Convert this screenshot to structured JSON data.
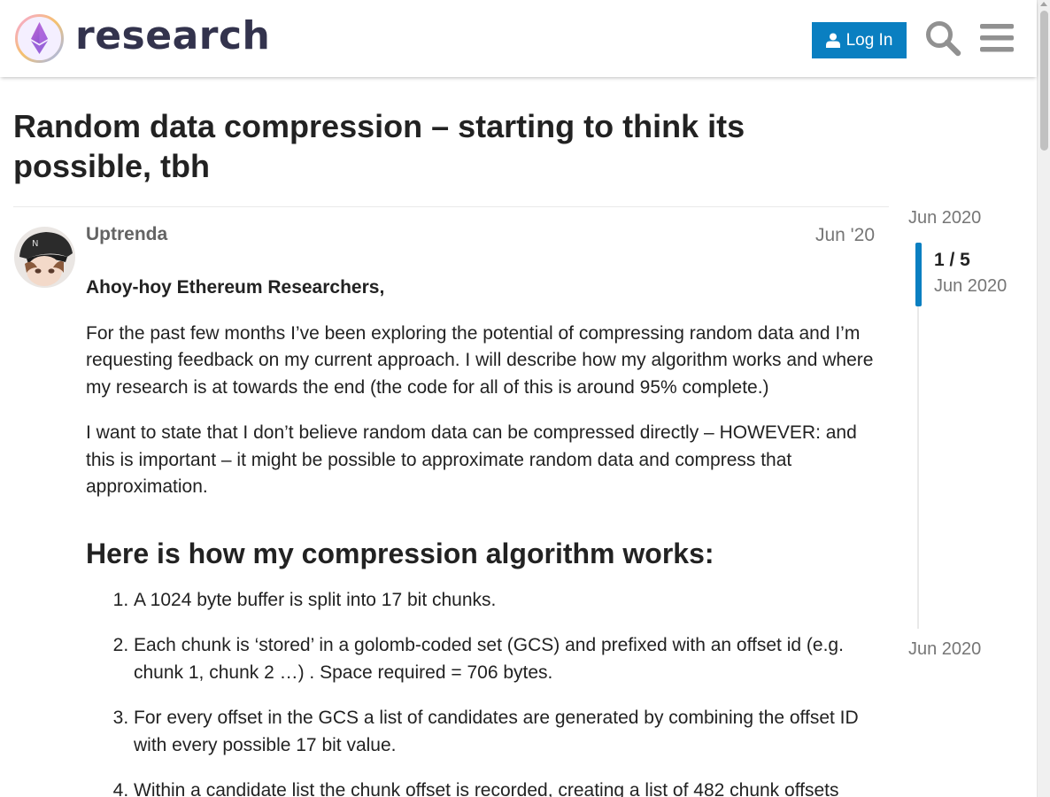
{
  "header": {
    "site_name": "research",
    "login_label": "Log In"
  },
  "topic": {
    "title": "Random data compression – starting to think its possible, tbh"
  },
  "post": {
    "author": "Uptrenda",
    "date": "Jun '20",
    "greeting": "Ahoy-hoy Ethereum Researchers,",
    "paragraphs": [
      "For the past few months I’ve been exploring the potential of compressing random data and I’m requesting feedback on my current approach. I will describe how my algorithm works and where my research is at towards the end (the code for all of this is around 95% complete.)",
      "I want to state that I don’t believe random data can be compressed directly – HOWEVER: and this is important – it might be possible to approximate random data and compress that approximation."
    ],
    "heading": "Here is how my compression algorithm works:",
    "steps": [
      "A 1024 byte buffer is split into 17 bit chunks.",
      "Each chunk is ‘stored’ in a golomb-coded set (GCS) and prefixed with an offset id (e.g. chunk 1, chunk 2 …) . Space required = 706 bytes.",
      "For every offset in the GCS a list of candidates are generated by combining the offset ID with every possible 17 bit value.",
      "Within a candidate list the chunk offset is recorded, creating a list of 482 chunk offsets"
    ]
  },
  "timeline": {
    "start_date": "Jun 2020",
    "position": "1 / 5",
    "current_date": "Jun 2020",
    "end_date": "Jun 2020"
  },
  "icons": {
    "logo": "ethereum-research-logo",
    "login": "user-icon",
    "search": "search-icon",
    "menu": "hamburger-menu-icon"
  },
  "colors": {
    "accent": "#0a7fc1",
    "logo_text": "#33334d",
    "muted_text": "#767676",
    "username": "#646464"
  }
}
